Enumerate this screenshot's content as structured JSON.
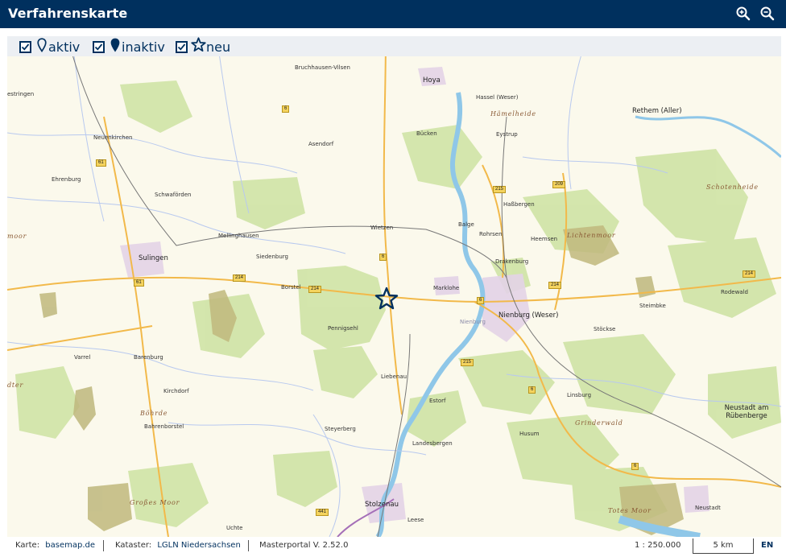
{
  "header": {
    "title": "Verfahrenskarte",
    "zoom_in_icon": "zoom-in-icon",
    "zoom_out_icon": "zoom-out-icon"
  },
  "legend": {
    "items": [
      {
        "label": "aktiv",
        "checked": true,
        "icon": "map-pin-outline-icon"
      },
      {
        "label": "inaktiv",
        "checked": true,
        "icon": "map-pin-filled-icon"
      },
      {
        "label": "neu",
        "checked": true,
        "icon": "star-outline-icon"
      }
    ]
  },
  "map": {
    "places": [
      "Bruchhausen-Vilsen",
      "Hoya",
      "Hassel (Weser)",
      "Hämelheide",
      "Rethem (Aller)",
      "Nienburg (Weser)",
      "Sulingen",
      "Marklohe",
      "Nienburg",
      "Drakenburg",
      "Heemsen",
      "Lichtenmoor",
      "Steimbke",
      "Rodewald",
      "Stöckse",
      "Linsburg",
      "Grinderwald",
      "Husum",
      "Estorf",
      "Liebenau",
      "Pennigsehl",
      "Borstel",
      "Siedenburg",
      "Mellinghausen",
      "Wietzen",
      "Bücken",
      "Asendorf",
      "Eystrup",
      "Haßbergen",
      "Balge",
      "Rohrsen",
      "Schwaförden",
      "Ehrenburg",
      "Neuenkirchen",
      "Varrel",
      "Barenburg",
      "Kirchdorf",
      "Bahrenborstel",
      "Böhrde",
      "Großes Moor",
      "Steyerberg",
      "Landesbergen",
      "Stolzenau",
      "Leese",
      "Uchte",
      "Neustadt am Rübenberge",
      "Neustadt",
      "Totes Moor",
      "Schotenheide",
      "estringen",
      "moor",
      "dter"
    ],
    "roads": [
      "6",
      "61",
      "214",
      "215",
      "209",
      "6",
      "214",
      "214",
      "6",
      "215",
      "6",
      "214",
      "6",
      "61",
      "441"
    ],
    "marker_icon": "star-marker-icon"
  },
  "footer": {
    "karte_label": "Karte:",
    "karte_link": "basemap.de",
    "kataster_label": "Kataster:",
    "kataster_link": "LGLN Niedersachsen",
    "version": "Masterportal V. 2.52.0",
    "scale": "1 : 250.000",
    "scale_bar": "5 km",
    "language": "EN"
  },
  "colors": {
    "header_bg": "#00305e",
    "legend_bg": "#eceff3",
    "map_bg": "#fbf9ec",
    "forest": "#cfe3a6",
    "water": "#8fc7e8",
    "road_yellow": "#f4d35e"
  }
}
